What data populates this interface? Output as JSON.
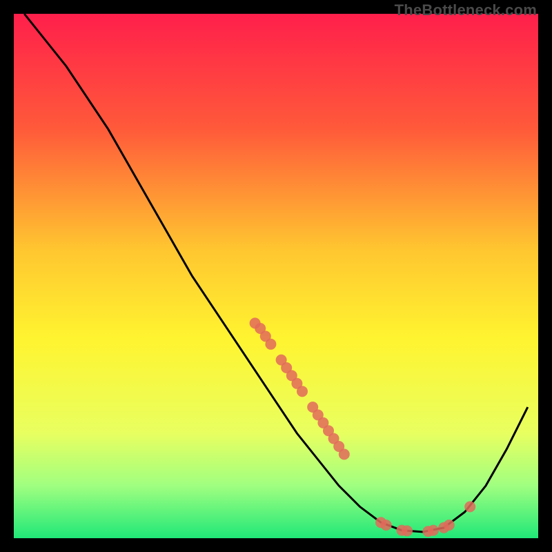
{
  "watermark": "TheBottleneck.com",
  "chart_data": {
    "type": "line",
    "title": "",
    "xlabel": "",
    "ylabel": "",
    "xlim": [
      0,
      100
    ],
    "ylim": [
      0,
      100
    ],
    "background_gradient": {
      "stops": [
        {
          "offset": 0.0,
          "color": "#ff1f4b"
        },
        {
          "offset": 0.22,
          "color": "#ff5a3a"
        },
        {
          "offset": 0.45,
          "color": "#ffc630"
        },
        {
          "offset": 0.62,
          "color": "#fff430"
        },
        {
          "offset": 0.8,
          "color": "#e8ff60"
        },
        {
          "offset": 0.9,
          "color": "#a0ff80"
        },
        {
          "offset": 1.0,
          "color": "#20e878"
        }
      ]
    },
    "curve": [
      {
        "x": 2,
        "y": 100
      },
      {
        "x": 6,
        "y": 95
      },
      {
        "x": 10,
        "y": 90
      },
      {
        "x": 14,
        "y": 84
      },
      {
        "x": 18,
        "y": 78
      },
      {
        "x": 22,
        "y": 71
      },
      {
        "x": 26,
        "y": 64
      },
      {
        "x": 30,
        "y": 57
      },
      {
        "x": 34,
        "y": 50
      },
      {
        "x": 38,
        "y": 44
      },
      {
        "x": 42,
        "y": 38
      },
      {
        "x": 46,
        "y": 32
      },
      {
        "x": 50,
        "y": 26
      },
      {
        "x": 54,
        "y": 20
      },
      {
        "x": 58,
        "y": 15
      },
      {
        "x": 62,
        "y": 10
      },
      {
        "x": 66,
        "y": 6
      },
      {
        "x": 70,
        "y": 3
      },
      {
        "x": 74,
        "y": 1.5
      },
      {
        "x": 78,
        "y": 1.2
      },
      {
        "x": 82,
        "y": 2
      },
      {
        "x": 86,
        "y": 5
      },
      {
        "x": 90,
        "y": 10
      },
      {
        "x": 94,
        "y": 17
      },
      {
        "x": 98,
        "y": 25
      }
    ],
    "markers": [
      {
        "x": 46,
        "y": 41
      },
      {
        "x": 47,
        "y": 40
      },
      {
        "x": 48,
        "y": 38.5
      },
      {
        "x": 49,
        "y": 37
      },
      {
        "x": 51,
        "y": 34
      },
      {
        "x": 52,
        "y": 32.5
      },
      {
        "x": 53,
        "y": 31
      },
      {
        "x": 54,
        "y": 29.5
      },
      {
        "x": 55,
        "y": 28
      },
      {
        "x": 57,
        "y": 25
      },
      {
        "x": 58,
        "y": 23.5
      },
      {
        "x": 59,
        "y": 22
      },
      {
        "x": 60,
        "y": 20.5
      },
      {
        "x": 61,
        "y": 19
      },
      {
        "x": 62,
        "y": 17.5
      },
      {
        "x": 63,
        "y": 16
      },
      {
        "x": 70,
        "y": 3
      },
      {
        "x": 71,
        "y": 2.5
      },
      {
        "x": 74,
        "y": 1.5
      },
      {
        "x": 75,
        "y": 1.4
      },
      {
        "x": 79,
        "y": 1.3
      },
      {
        "x": 80,
        "y": 1.5
      },
      {
        "x": 82,
        "y": 2
      },
      {
        "x": 83,
        "y": 2.5
      },
      {
        "x": 87,
        "y": 6
      }
    ],
    "marker_color": "#e26a5a",
    "curve_color": "#000000"
  }
}
